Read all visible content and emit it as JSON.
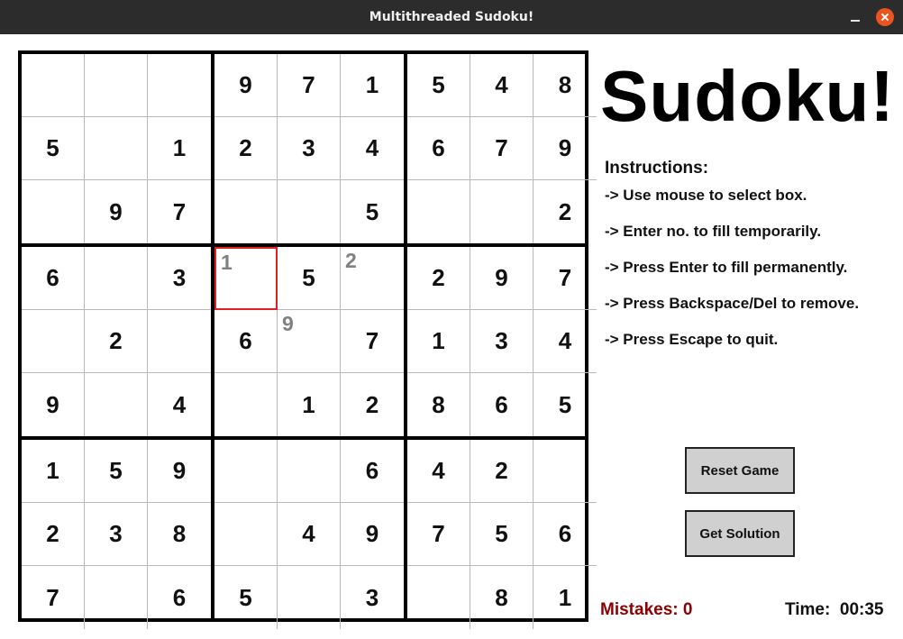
{
  "window": {
    "title": "Multithreaded Sudoku!"
  },
  "board": {
    "rows": [
      [
        "",
        "",
        "",
        "9",
        "7",
        "1",
        "5",
        "4",
        "8"
      ],
      [
        "5",
        "",
        "1",
        "2",
        "3",
        "4",
        "6",
        "7",
        "9"
      ],
      [
        "",
        "9",
        "7",
        "",
        "",
        "5",
        "",
        "",
        "2"
      ],
      [
        "6",
        "",
        "3",
        "",
        "5",
        "",
        "2",
        "9",
        "7"
      ],
      [
        "",
        "2",
        "",
        "6",
        "",
        "7",
        "1",
        "3",
        "4"
      ],
      [
        "9",
        "",
        "4",
        "",
        "1",
        "2",
        "8",
        "6",
        "5"
      ],
      [
        "1",
        "5",
        "9",
        "",
        "",
        "6",
        "4",
        "2",
        ""
      ],
      [
        "2",
        "3",
        "8",
        "",
        "4",
        "9",
        "7",
        "5",
        "6"
      ],
      [
        "7",
        "",
        "6",
        "5",
        "",
        "3",
        "",
        "8",
        "1"
      ]
    ],
    "temporary": [
      {
        "row": 3,
        "col": 3,
        "value": "1"
      },
      {
        "row": 3,
        "col": 5,
        "value": "2"
      },
      {
        "row": 4,
        "col": 4,
        "value": "9"
      }
    ],
    "selected": {
      "row": 3,
      "col": 3
    },
    "colors": {
      "selected_border": "#e02020",
      "temporary_text": "#808080"
    }
  },
  "heading": "Sudoku!",
  "instructions": {
    "title": "Instructions:",
    "items": [
      "-> Use mouse to select box.",
      "-> Enter no. to fill temporarily.",
      "-> Press Enter to fill permanently.",
      "-> Press Backspace/Del to remove.",
      "-> Press Escape to quit."
    ]
  },
  "buttons": {
    "reset": "Reset Game",
    "solution": "Get Solution"
  },
  "status": {
    "mistakes": "Mistakes: 0",
    "time": "Time:  00:35",
    "mistakes_color": "#8b0000"
  }
}
